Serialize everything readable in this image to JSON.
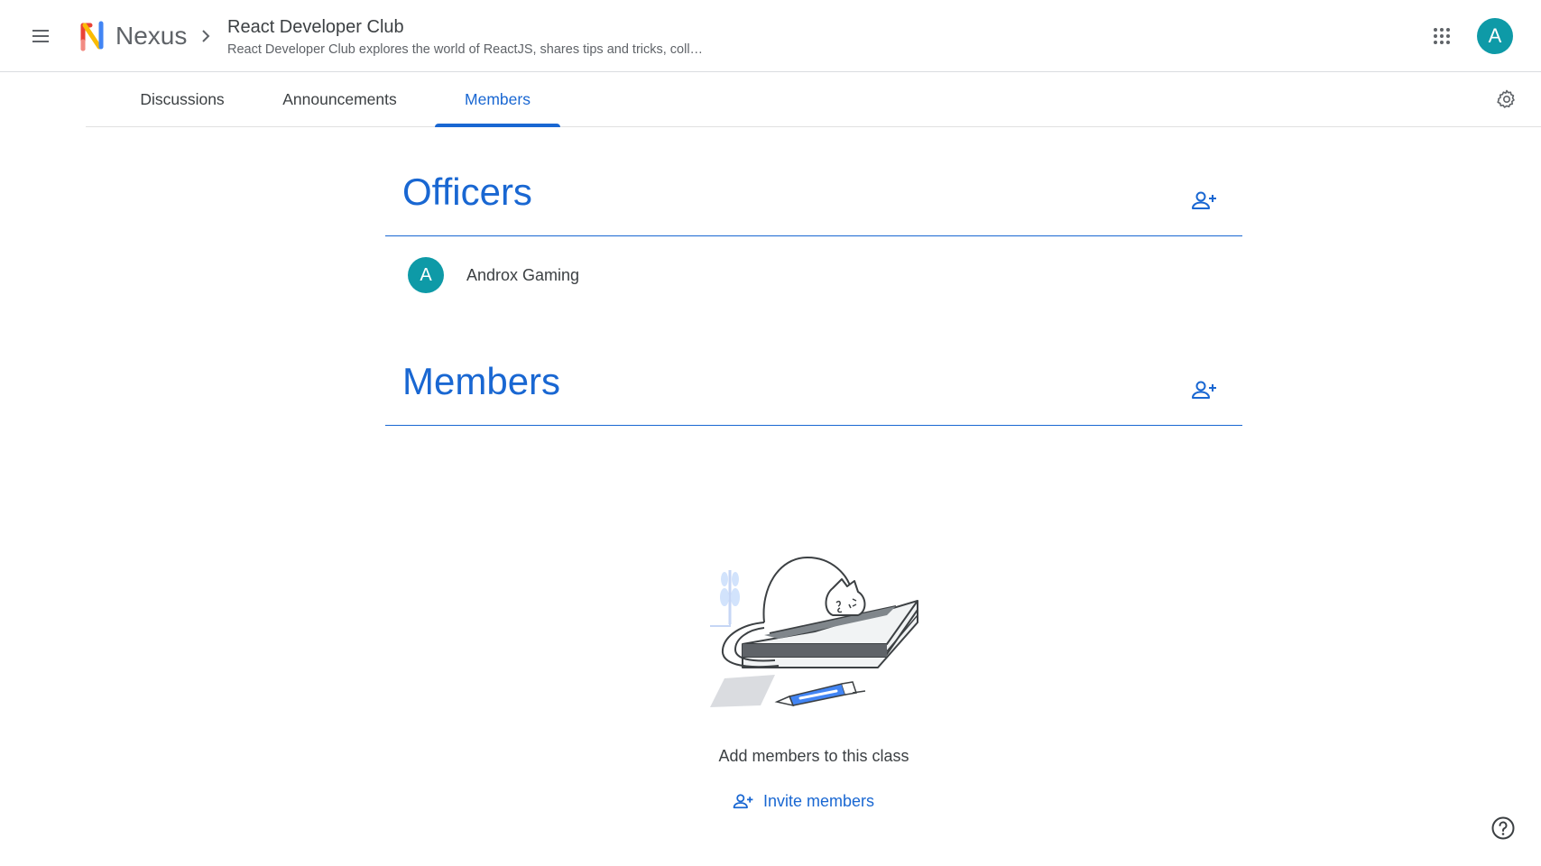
{
  "header": {
    "menu_icon": "hamburger-menu-icon",
    "brand": "Nexus",
    "class_title": "React Developer Club",
    "class_description": "React Developer Club explores the world of ReactJS, shares tips and tricks, coll…",
    "apps_icon": "apps-grid-icon",
    "user_initial": "A"
  },
  "tabs": [
    {
      "label": "Discussions",
      "active": false
    },
    {
      "label": "Announcements",
      "active": false
    },
    {
      "label": "Members",
      "active": true
    }
  ],
  "settings_icon": "gear-icon",
  "officers": {
    "title": "Officers",
    "add_icon": "add-person-icon",
    "list": [
      {
        "initial": "A",
        "name": "Androx Gaming"
      }
    ]
  },
  "members": {
    "title": "Members",
    "add_icon": "add-person-icon",
    "empty_text": "Add members to this class",
    "invite_label": "Invite members"
  },
  "help_icon": "help-circle-icon",
  "colors": {
    "accent": "#1967d2",
    "avatar": "#0e9aa7",
    "divider": "#dadce0"
  }
}
